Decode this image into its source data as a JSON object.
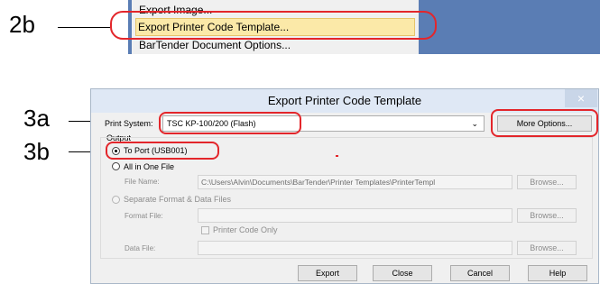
{
  "annotations": {
    "step_2b": "2b",
    "step_3a": "3a",
    "step_3b": "3b"
  },
  "menu": {
    "items": [
      "Export Image...",
      "Export Printer Code Template...",
      "BarTender Document Options..."
    ]
  },
  "dialog": {
    "title": "Export Printer Code Template",
    "close_glyph": "×",
    "print_system_label": "Print System:",
    "print_system_value": "TSC KP-100/200 (Flash)",
    "dropdown_glyph": "⌄",
    "more_options_label": "More Options...",
    "output_label": "Output",
    "to_port_label": "To Port (USB001)",
    "all_in_one_label": "All in One File",
    "file_name_label": "File Name:",
    "file_name_value": "C:\\Users\\Alvin\\Documents\\BarTender\\Printer Templates\\PrinterTempl",
    "browse_label": "Browse...",
    "separate_label": "Separate Format & Data Files",
    "format_file_label": "Format File:",
    "printer_code_only_label": "Printer Code Only",
    "data_file_label": "Data File:",
    "buttons": {
      "export": "Export",
      "close": "Close",
      "cancel": "Cancel",
      "help": "Help"
    }
  },
  "colors": {
    "highlight": "#e3262b",
    "menu_hover": "#fbe9a8",
    "desktop_blue": "#5a7db4"
  }
}
